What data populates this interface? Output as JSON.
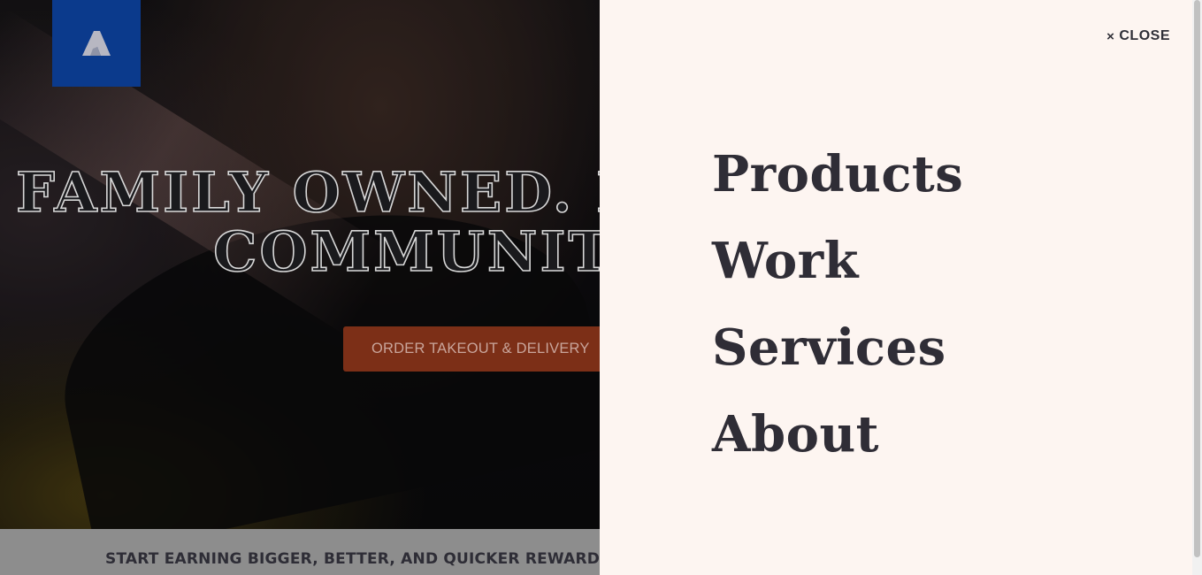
{
  "hero": {
    "headline_line1": "FAMILY OWNED. FAMILY",
    "headline_line2": "COMMUNITY",
    "order_button": "ORDER TAKEOUT & DELIVERY",
    "logo_icon": "brand-logo-icon"
  },
  "rewards": {
    "text": "START EARNING BIGGER, BETTER, AND QUICKER REWARDS"
  },
  "menu": {
    "close_label": "CLOSE",
    "close_icon": "×",
    "items": [
      {
        "label": "Products"
      },
      {
        "label": "Work"
      },
      {
        "label": "Services"
      },
      {
        "label": "About"
      }
    ]
  },
  "colors": {
    "logo_bg": "#0b3a8c",
    "button_bg": "#7c2f17",
    "panel_bg": "#fdf5f1",
    "menu_text": "#2f2d36"
  }
}
